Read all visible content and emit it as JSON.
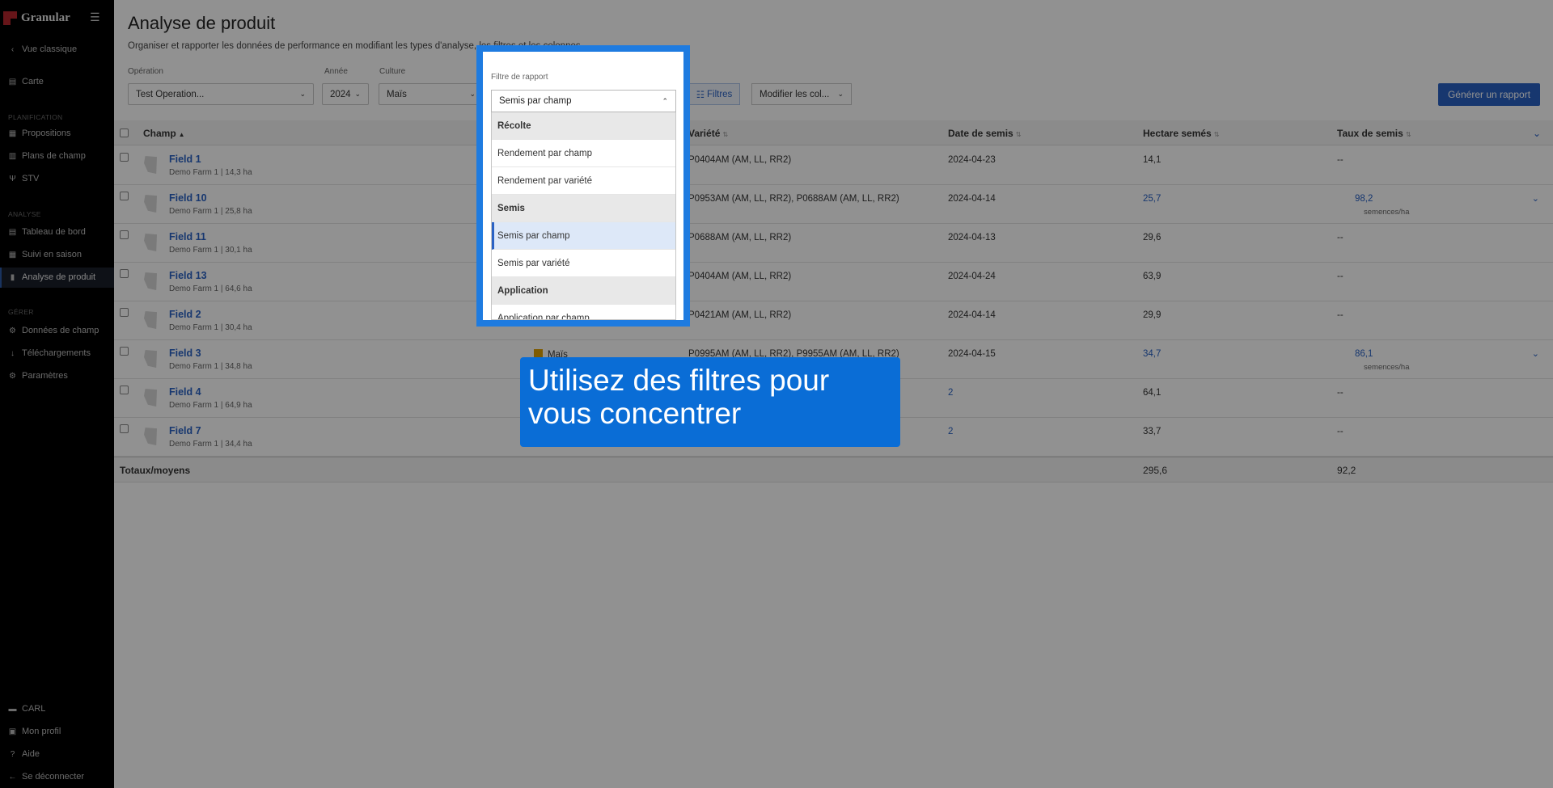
{
  "sidebar": {
    "brand": "Granular",
    "back": "Vue classique",
    "map": "Carte",
    "sections": {
      "planning": "PLANIFICATION",
      "analysis": "ANALYSE",
      "manage": "GÉRER"
    },
    "planning_items": [
      "Propositions",
      "Plans de champ",
      "STV"
    ],
    "analysis_items": [
      "Tableau de bord",
      "Suivi en saison",
      "Analyse de produit"
    ],
    "manage_items": [
      "Données de champ",
      "Téléchargements",
      "Paramètres"
    ],
    "bottom_items": [
      "CARL",
      "Mon profil",
      "Aide",
      "Se déconnecter"
    ]
  },
  "header": {
    "title": "Analyse de produit",
    "subtitle": "Organiser et rapporter les données de performance en modifiant les types d'analyse, les filtres et les colonnes."
  },
  "filters": {
    "operation": {
      "label": "Opération",
      "value": "Test Operation..."
    },
    "year": {
      "label": "Année",
      "value": "2024"
    },
    "crop": {
      "label": "Culture",
      "value": "Maïs"
    },
    "filters_button": "Filtres",
    "columns_button": "Modifier les col...",
    "generate_button": "Générer un rapport"
  },
  "table": {
    "columns": {
      "field": "Champ",
      "variety": "Variété",
      "seed_date": "Date de semis",
      "hectares": "Hectare semés",
      "rate": "Taux de semis"
    },
    "rows": [
      {
        "name": "Field 1",
        "sub": "Demo Farm 1 | 14,3 ha",
        "crop": "",
        "variety": "P0404AM (AM, LL, RR2)",
        "date": "2024-04-23",
        "hectares": "14,1",
        "rate": "--",
        "rate_unit": "",
        "link": false
      },
      {
        "name": "Field 10",
        "sub": "Demo Farm 1 | 25,8 ha",
        "crop": "",
        "variety": "P0953AM (AM, LL, RR2), P0688AM (AM, LL, RR2)",
        "date": "2024-04-14",
        "hectares": "25,7",
        "rate": "98,2",
        "rate_unit": "semences/ha",
        "link": true
      },
      {
        "name": "Field 11",
        "sub": "Demo Farm 1 | 30,1 ha",
        "crop": "",
        "variety": "P0688AM (AM, LL, RR2)",
        "date": "2024-04-13",
        "hectares": "29,6",
        "rate": "--",
        "rate_unit": "",
        "link": false
      },
      {
        "name": "Field 13",
        "sub": "Demo Farm 1 | 64,6 ha",
        "crop": "",
        "variety": "P0404AM (AM, LL, RR2)",
        "date": "2024-04-24",
        "hectares": "63,9",
        "rate": "--",
        "rate_unit": "",
        "link": false
      },
      {
        "name": "Field 2",
        "sub": "Demo Farm 1 | 30,4 ha",
        "crop": "",
        "variety": "P0421AM (AM, LL, RR2)",
        "date": "2024-04-14",
        "hectares": "29,9",
        "rate": "--",
        "rate_unit": "",
        "link": false
      },
      {
        "name": "Field 3",
        "sub": "Demo Farm 1 | 34,8 ha",
        "crop": "Maïs",
        "variety": "P0995AM (AM, LL, RR2), P9955AM (AM, LL, RR2)",
        "date": "2024-04-15",
        "hectares": "34,7",
        "rate": "86,1",
        "rate_unit": "semences/ha",
        "link": true
      },
      {
        "name": "Field 4",
        "sub": "Demo Farm 1 | 64,9 ha",
        "crop": "",
        "variety": "",
        "date": "2",
        "hectares": "64,1",
        "rate": "--",
        "rate_unit": "",
        "link": false
      },
      {
        "name": "Field 7",
        "sub": "Demo Farm 1 | 34,4 ha",
        "crop": "",
        "variety": "",
        "date": "2",
        "hectares": "33,7",
        "rate": "--",
        "rate_unit": "",
        "link": false
      }
    ],
    "totals": {
      "label": "Totaux/moyens",
      "hectares": "295,6",
      "rate": "92,2"
    }
  },
  "report_filter": {
    "label": "Filtre de rapport",
    "value": "Semis par champ",
    "options": [
      {
        "text": "Récolte",
        "type": "group"
      },
      {
        "text": "Rendement par champ",
        "type": "item"
      },
      {
        "text": "Rendement par variété",
        "type": "item"
      },
      {
        "text": "Semis",
        "type": "group"
      },
      {
        "text": "Semis par champ",
        "type": "selected"
      },
      {
        "text": "Semis par variété",
        "type": "item"
      },
      {
        "text": "Application",
        "type": "group"
      },
      {
        "text": "Application par champ",
        "type": "item"
      }
    ]
  },
  "callout": {
    "text": "Utilisez des filtres pour vous concentrer"
  },
  "colors": {
    "accent": "#2a62c4",
    "highlight": "#1e7be0",
    "callout": "#0a6dd6",
    "sidebar": "#000000"
  }
}
